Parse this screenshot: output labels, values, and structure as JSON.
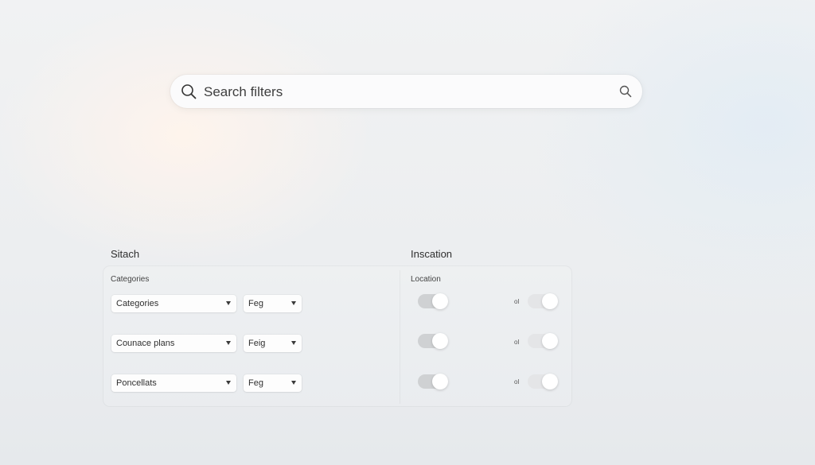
{
  "search": {
    "placeholder": "Search filters",
    "value": ""
  },
  "left_section": {
    "title": "Sitach",
    "sub_label": "Categories",
    "rows": [
      {
        "primary": "Categories",
        "secondary": "Feg"
      },
      {
        "primary": "Counace plans",
        "secondary": "Feig"
      },
      {
        "primary": "Poncellats",
        "secondary": "Feg"
      }
    ]
  },
  "right_section": {
    "title": "Inscation",
    "sub_label": "Location",
    "rows": [
      {
        "mini_label": "ol"
      },
      {
        "mini_label": "ol"
      },
      {
        "mini_label": "ol"
      }
    ]
  },
  "icons": {
    "search_left": "search-icon",
    "search_right": "search-icon",
    "dropdown": "chevron-down-icon"
  },
  "colors": {
    "toggle_track_grey": "#cfd1d3",
    "toggle_track_light": "#e4e5e7"
  }
}
